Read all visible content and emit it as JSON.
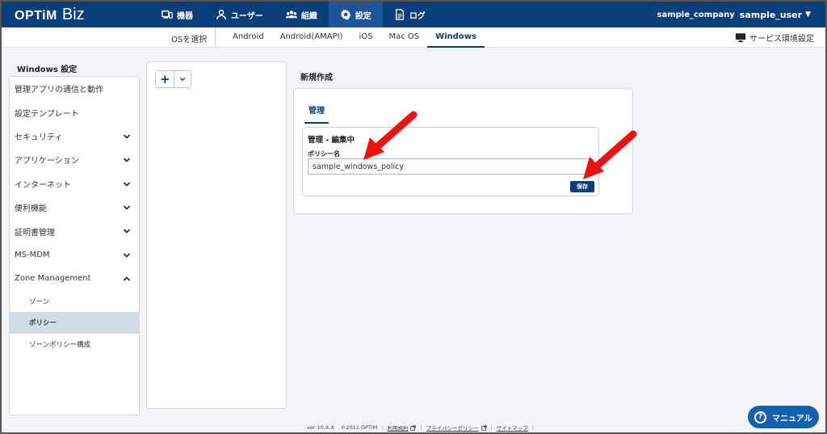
{
  "header": {
    "brand": "OPTiM",
    "product": "Biz",
    "nav": [
      {
        "label": "機器",
        "icon": "device-icon"
      },
      {
        "label": "ユーザー",
        "icon": "user-icon"
      },
      {
        "label": "組織",
        "icon": "group-icon"
      },
      {
        "label": "設定",
        "icon": "gear-icon"
      },
      {
        "label": "ログ",
        "icon": "document-icon"
      }
    ],
    "active_nav": "設定",
    "company": "sample_company",
    "user": "sample_user"
  },
  "os_bar": {
    "label": "OSを選択",
    "tabs": [
      "Android",
      "Android(AMAPI)",
      "iOS",
      "Mac OS",
      "Windows"
    ],
    "active_tab": "Windows",
    "service_settings": "サービス環境設定"
  },
  "sidebar": {
    "title": "Windows 設定",
    "items": [
      {
        "label": "管理アプリの通信と動作",
        "chevron": "none"
      },
      {
        "label": "設定テンプレート",
        "chevron": "none"
      },
      {
        "label": "セキュリティ",
        "chevron": "down"
      },
      {
        "label": "アプリケーション",
        "chevron": "down"
      },
      {
        "label": "インターネット",
        "chevron": "down"
      },
      {
        "label": "便利機能",
        "chevron": "down"
      },
      {
        "label": "証明書管理",
        "chevron": "down"
      },
      {
        "label": "MS-MDM",
        "chevron": "down"
      },
      {
        "label": "Zone Management",
        "chevron": "up"
      }
    ],
    "subitems": [
      {
        "label": "ゾーン",
        "active": false
      },
      {
        "label": "ポリシー",
        "active": true
      },
      {
        "label": "ゾーンポリシー構成",
        "active": false
      }
    ]
  },
  "middle": {
    "add_label": "+"
  },
  "content": {
    "title": "新規作成",
    "tab": "管理",
    "section_title": "管理 - 編集中",
    "field_label": "ポリシー名",
    "field_value": "sample_windows_policy",
    "save_label": "保存"
  },
  "footer": {
    "version": "ver 10.X.X",
    "copyright": "©2011 OPTiM",
    "terms": "利用規約",
    "privacy": "プライバシーポリシー",
    "sitemap": "サイトマップ"
  },
  "manual_button": "マニュアル",
  "colors": {
    "header": "#0b3f7a",
    "accent": "#1660b0",
    "arrow": "#ee1111",
    "active_subitem": "#d3dbe6"
  }
}
